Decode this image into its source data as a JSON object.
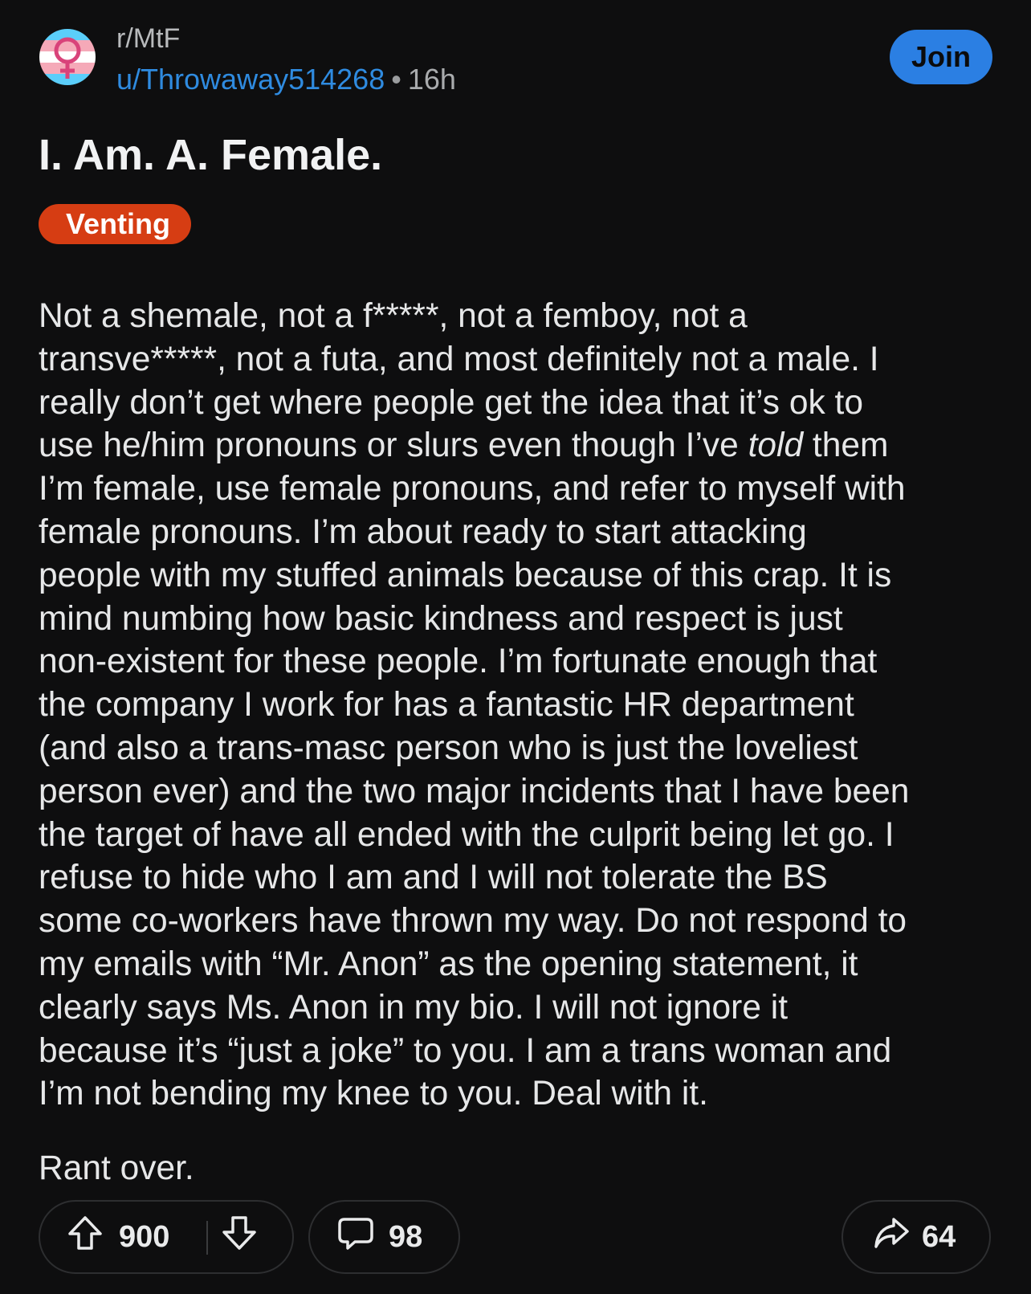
{
  "header": {
    "subreddit": "r/MtF",
    "username": "u/Throwaway514268",
    "separator": "•",
    "time_ago": "16h",
    "join_label": "Join",
    "avatar_icon": "trans-flag-female-symbol-icon"
  },
  "post": {
    "title": "I. Am. A. Female.",
    "flair": "Venting",
    "body_lines": [
      "Not a shemale, not a f*****, not a femboy, not a",
      "transve*****, not a futa, and most definitely not a male. I",
      "really don’t get where people get the idea that it’s ok to",
      "I’m female, use female pronouns, and refer to myself with",
      "female pronouns. I’m about ready to start attacking",
      "people with my stuffed animals because of this crap. It is",
      "mind numbing how basic kindness and respect is just",
      "non-existent for these people. I’m fortunate enough that",
      "the company I work for has a fantastic HR department",
      "(and also a trans-masc person who is just the loveliest",
      "person ever) and the two major incidents that I have been",
      "the target of have all ended with the culprit being let go. I",
      "refuse to hide who I am and I will not tolerate the BS",
      "some co-workers have thrown my way. Do not respond to",
      "my emails with “Mr. Anon” as the opening statement, it",
      "clearly says Ms. Anon in my bio. I will not ignore it",
      "because it’s “just a joke” to you. I am a trans woman and",
      "I’m not bending my knee to you. Deal with it."
    ],
    "line4_before": "use he/him pronouns or slurs even though I’ve ",
    "line4_italic": "told",
    "line4_after": " them",
    "closing": "Rant over."
  },
  "actions": {
    "upvotes": "900",
    "comments": "98",
    "shares": "64",
    "icons": [
      "upvote-arrow-icon",
      "downvote-arrow-icon",
      "comment-bubble-icon",
      "share-arrow-icon"
    ]
  },
  "colors": {
    "background": "#0e0e0f",
    "link_blue": "#2f8be0",
    "join_button": "#2b7fe3",
    "flair_orange": "#d63d13"
  }
}
